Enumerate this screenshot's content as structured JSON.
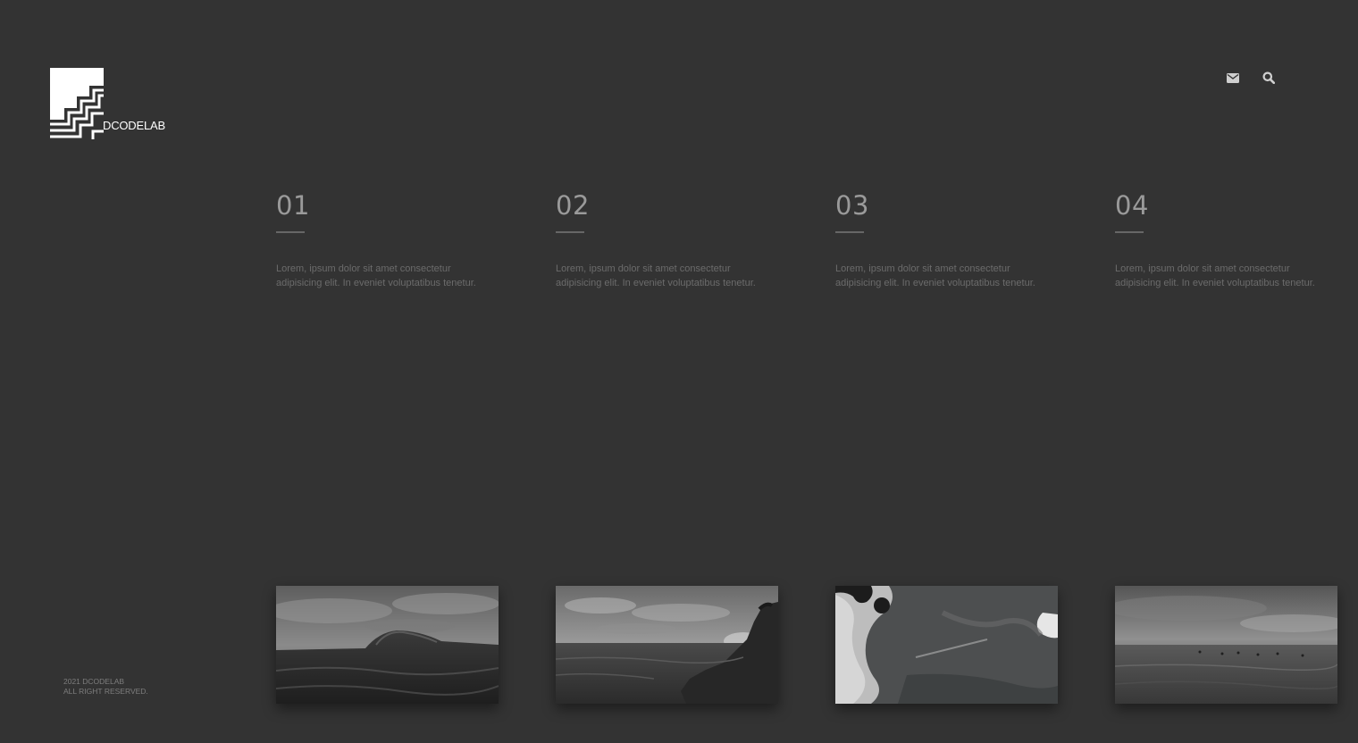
{
  "brand": {
    "name": "DCODELAB"
  },
  "header": {
    "icons": [
      "envelope-icon",
      "search-icon"
    ]
  },
  "features": [
    {
      "number": "01",
      "text": "Lorem, ipsum dolor sit amet consectetur adipisicing elit. In eveniet voluptatibus tenetur."
    },
    {
      "number": "02",
      "text": "Lorem, ipsum dolor sit amet consectetur adipisicing elit. In eveniet voluptatibus tenetur."
    },
    {
      "number": "03",
      "text": "Lorem, ipsum dolor sit amet consectetur adipisicing elit. In eveniet voluptatibus tenetur."
    },
    {
      "number": "04",
      "text": "Lorem, ipsum dolor sit amet consectetur adipisicing elit. In eveniet voluptatibus tenetur."
    }
  ],
  "gallery": [
    {
      "subject": "breaking-wave"
    },
    {
      "subject": "rocky-coast-sunset"
    },
    {
      "subject": "aerial-surf-foam"
    },
    {
      "subject": "calm-sea-surfers"
    }
  ],
  "footer": {
    "line1": "2021 DCODELAB",
    "line2": "ALL RIGHT RESERVED."
  },
  "colors": {
    "background": "#333333",
    "accent": "#ffffff",
    "muted_text": "#6b6b6b",
    "number_text": "#9a9a9a"
  }
}
